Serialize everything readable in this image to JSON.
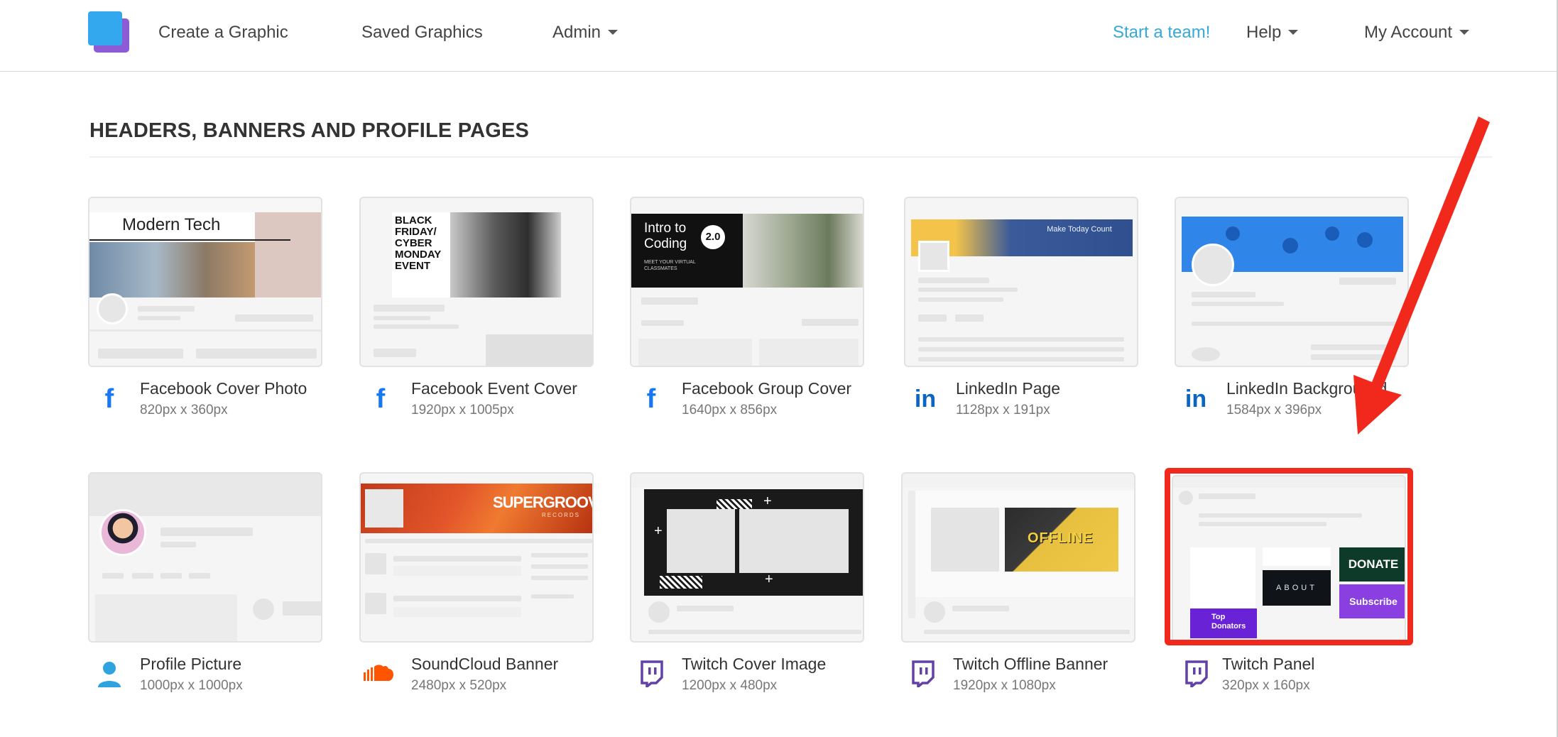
{
  "nav": {
    "create": "Create a Graphic",
    "saved": "Saved Graphics",
    "admin": "Admin",
    "team": "Start a team!",
    "help": "Help",
    "account": "My Account"
  },
  "section": {
    "title": "HEADERS, BANNERS AND PROFILE PAGES"
  },
  "cards": [
    {
      "title": "Facebook Cover Photo",
      "size": "820px x 360px",
      "icon": "facebook-icon",
      "thumb_text": "Modern Tech"
    },
    {
      "title": "Facebook Event Cover",
      "size": "1920px x 1005px",
      "icon": "facebook-icon",
      "thumb_text": "BLACK FRIDAY/ CYBER MONDAY EVENT"
    },
    {
      "title": "Facebook Group Cover",
      "size": "1640px x 856px",
      "icon": "facebook-icon",
      "thumb_text": "Intro to Coding",
      "thumb_badge": "2.0",
      "thumb_sub": "MEET YOUR VIRTUAL CLASSMATES"
    },
    {
      "title": "LinkedIn Page",
      "size": "1128px x 191px",
      "icon": "linkedin-icon",
      "thumb_text": "Make Today Count"
    },
    {
      "title": "LinkedIn Backgrou…d",
      "size": "1584px x 396px",
      "icon": "linkedin-icon"
    },
    {
      "title": "Profile Picture",
      "size": "1000px x 1000px",
      "icon": "person-icon"
    },
    {
      "title": "SoundCloud Banner",
      "size": "2480px x 520px",
      "icon": "soundcloud-icon",
      "thumb_text": "SUPERGROOVE",
      "thumb_sub": "RECORDS"
    },
    {
      "title": "Twitch Cover Image",
      "size": "1200px x 480px",
      "icon": "twitch-icon"
    },
    {
      "title": "Twitch Offline Banner",
      "size": "1920px x 1080px",
      "icon": "twitch-icon",
      "thumb_text": "OFFLINE"
    },
    {
      "title": "Twitch Panel",
      "size": "320px x 160px",
      "icon": "twitch-icon",
      "thumb_donate": "DONATE",
      "thumb_about": "ABOUT",
      "thumb_top": "Top Donators",
      "thumb_subscribe": "Subscribe"
    }
  ],
  "colors": {
    "accent": "#37a8d8",
    "highlight": "#f0291c",
    "facebook": "#1877f2",
    "linkedin": "#0a66c2",
    "twitch": "#6441a5",
    "soundcloud": "#ff5500"
  }
}
